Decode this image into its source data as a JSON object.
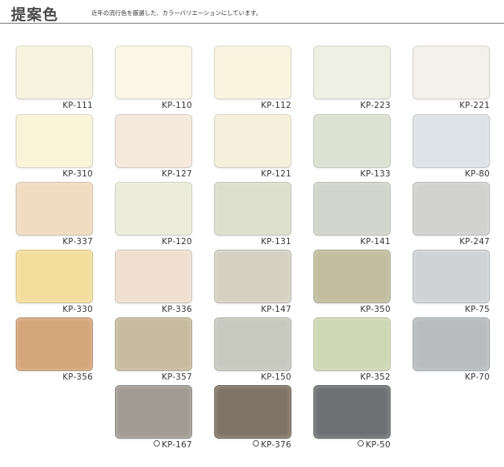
{
  "header": {
    "title": "提案色",
    "subtitle": "近年の流行色を厳選した、カラーバリエーションにしています。"
  },
  "swatches": [
    {
      "code": "KP-111",
      "color": "#f8f3df",
      "marked": false
    },
    {
      "code": "KP-110",
      "color": "#fbf6e6",
      "marked": false
    },
    {
      "code": "KP-112",
      "color": "#faf4df",
      "marked": false
    },
    {
      "code": "KP-223",
      "color": "#eef0e3",
      "marked": false
    },
    {
      "code": "KP-221",
      "color": "#f3f1e9",
      "marked": false
    },
    {
      "code": "KP-310",
      "color": "#faf4d8",
      "marked": false
    },
    {
      "code": "KP-127",
      "color": "#f5e8dc",
      "marked": false
    },
    {
      "code": "KP-121",
      "color": "#f6efdb",
      "marked": false
    },
    {
      "code": "KP-133",
      "color": "#dde1d1",
      "marked": false
    },
    {
      "code": "KP-80",
      "color": "#dee3e7",
      "marked": false
    },
    {
      "code": "KP-337",
      "color": "#f0dcc1",
      "marked": false
    },
    {
      "code": "KP-120",
      "color": "#ebedda",
      "marked": false
    },
    {
      "code": "KP-131",
      "color": "#dcdfcb",
      "marked": false
    },
    {
      "code": "KP-141",
      "color": "#d2d5cb",
      "marked": false
    },
    {
      "code": "KP-247",
      "color": "#d1d2d0",
      "marked": false
    },
    {
      "code": "KP-330",
      "color": "#f4de9e",
      "marked": false
    },
    {
      "code": "KP-336",
      "color": "#f0dfd1",
      "marked": false
    },
    {
      "code": "KP-147",
      "color": "#d5d1c2",
      "marked": false
    },
    {
      "code": "KP-350",
      "color": "#c2bd9e",
      "marked": false
    },
    {
      "code": "KP-75",
      "color": "#cfd3d6",
      "marked": false
    },
    {
      "code": "KP-356",
      "color": "#d5a57b",
      "marked": false
    },
    {
      "code": "KP-357",
      "color": "#c6bb9e",
      "marked": false
    },
    {
      "code": "KP-150",
      "color": "#c7c9bf",
      "marked": false
    },
    {
      "code": "KP-352",
      "color": "#cfd8b4",
      "marked": false
    },
    {
      "code": "KP-70",
      "color": "#b9bcbf",
      "marked": false
    },
    {
      "code": "KP-167",
      "color": "#a29b93",
      "marked": true
    },
    {
      "code": "KP-376",
      "color": "#7f7465",
      "marked": true
    },
    {
      "code": "KP-50",
      "color": "#6e7074",
      "marked": true
    }
  ]
}
